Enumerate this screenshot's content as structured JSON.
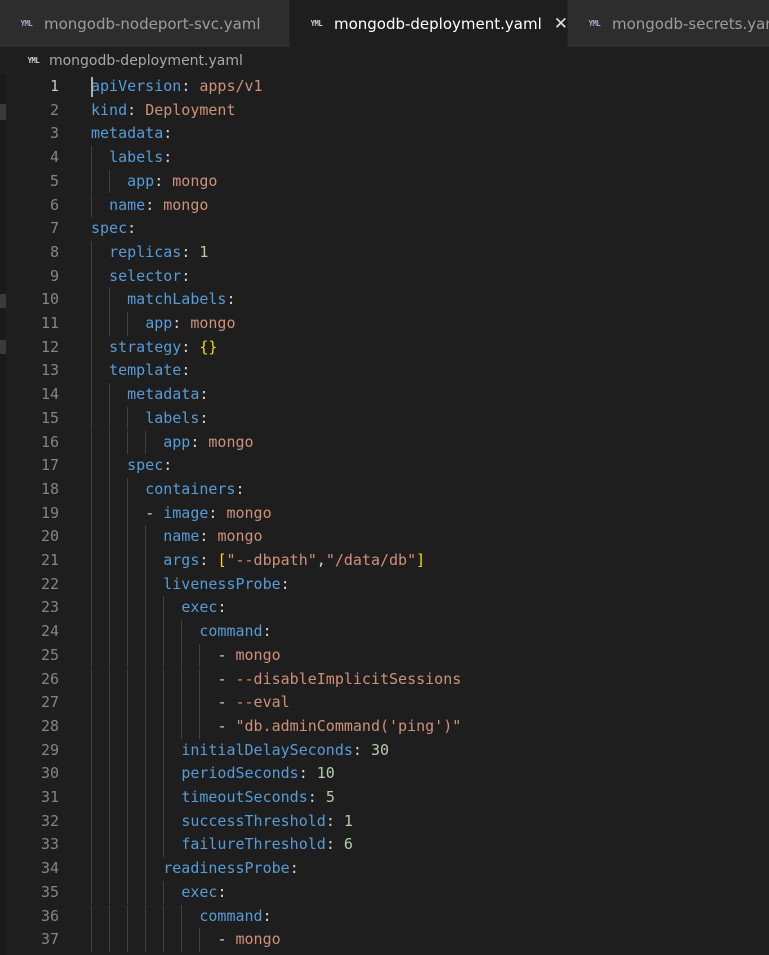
{
  "tabs": [
    {
      "label": "mongodb-nodeport-svc.yaml",
      "icon": "yml-icon"
    },
    {
      "label": "mongodb-deployment.yaml",
      "icon": "yml-icon",
      "active": true,
      "close": "✕"
    },
    {
      "label": "mongodb-secrets.yaml",
      "icon": "yml-icon"
    }
  ],
  "icon_text": "YML",
  "breadcrumb": "mongodb-deployment.yaml",
  "lines": [
    {
      "n": "1",
      "indent": 0,
      "parts": [
        [
          "k",
          "apiVersion"
        ],
        [
          "p",
          ": "
        ],
        [
          "s",
          "apps/v1"
        ]
      ]
    },
    {
      "n": "2",
      "indent": 0,
      "parts": [
        [
          "k",
          "kind"
        ],
        [
          "p",
          ": "
        ],
        [
          "s",
          "Deployment"
        ]
      ]
    },
    {
      "n": "3",
      "indent": 0,
      "parts": [
        [
          "k",
          "metadata"
        ],
        [
          "p",
          ":"
        ]
      ]
    },
    {
      "n": "4",
      "indent": 1,
      "parts": [
        [
          "k",
          "labels"
        ],
        [
          "p",
          ":"
        ]
      ]
    },
    {
      "n": "5",
      "indent": 2,
      "parts": [
        [
          "k",
          "app"
        ],
        [
          "p",
          ": "
        ],
        [
          "s",
          "mongo"
        ]
      ]
    },
    {
      "n": "6",
      "indent": 1,
      "parts": [
        [
          "k",
          "name"
        ],
        [
          "p",
          ": "
        ],
        [
          "s",
          "mongo"
        ]
      ]
    },
    {
      "n": "7",
      "indent": 0,
      "parts": [
        [
          "k",
          "spec"
        ],
        [
          "p",
          ":"
        ]
      ]
    },
    {
      "n": "8",
      "indent": 1,
      "parts": [
        [
          "k",
          "replicas"
        ],
        [
          "p",
          ": "
        ],
        [
          "n",
          "1"
        ]
      ]
    },
    {
      "n": "9",
      "indent": 1,
      "parts": [
        [
          "k",
          "selector"
        ],
        [
          "p",
          ":"
        ]
      ]
    },
    {
      "n": "10",
      "indent": 2,
      "parts": [
        [
          "k",
          "matchLabels"
        ],
        [
          "p",
          ":"
        ]
      ]
    },
    {
      "n": "11",
      "indent": 3,
      "parts": [
        [
          "k",
          "app"
        ],
        [
          "p",
          ": "
        ],
        [
          "s",
          "mongo"
        ]
      ]
    },
    {
      "n": "12",
      "indent": 1,
      "parts": [
        [
          "k",
          "strategy"
        ],
        [
          "p",
          ": "
        ],
        [
          "b",
          "{}"
        ]
      ]
    },
    {
      "n": "13",
      "indent": 1,
      "parts": [
        [
          "k",
          "template"
        ],
        [
          "p",
          ":"
        ]
      ]
    },
    {
      "n": "14",
      "indent": 2,
      "parts": [
        [
          "k",
          "metadata"
        ],
        [
          "p",
          ":"
        ]
      ]
    },
    {
      "n": "15",
      "indent": 3,
      "parts": [
        [
          "k",
          "labels"
        ],
        [
          "p",
          ":"
        ]
      ]
    },
    {
      "n": "16",
      "indent": 4,
      "parts": [
        [
          "k",
          "app"
        ],
        [
          "p",
          ": "
        ],
        [
          "s",
          "mongo"
        ]
      ]
    },
    {
      "n": "17",
      "indent": 2,
      "parts": [
        [
          "k",
          "spec"
        ],
        [
          "p",
          ":"
        ]
      ]
    },
    {
      "n": "18",
      "indent": 3,
      "parts": [
        [
          "k",
          "containers"
        ],
        [
          "p",
          ":"
        ]
      ]
    },
    {
      "n": "19",
      "indent": 3,
      "parts": [
        [
          "p",
          "- "
        ],
        [
          "k",
          "image"
        ],
        [
          "p",
          ": "
        ],
        [
          "s",
          "mongo"
        ]
      ]
    },
    {
      "n": "20",
      "indent": 4,
      "parts": [
        [
          "k",
          "name"
        ],
        [
          "p",
          ": "
        ],
        [
          "s",
          "mongo"
        ]
      ]
    },
    {
      "n": "21",
      "indent": 4,
      "parts": [
        [
          "k",
          "args"
        ],
        [
          "p",
          ": "
        ],
        [
          "b",
          "["
        ],
        [
          "s",
          "\"--dbpath\""
        ],
        [
          "p",
          ","
        ],
        [
          "s",
          "\"/data/db\""
        ],
        [
          "b",
          "]"
        ]
      ]
    },
    {
      "n": "22",
      "indent": 4,
      "parts": [
        [
          "k",
          "livenessProbe"
        ],
        [
          "p",
          ":"
        ]
      ]
    },
    {
      "n": "23",
      "indent": 5,
      "parts": [
        [
          "k",
          "exec"
        ],
        [
          "p",
          ":"
        ]
      ]
    },
    {
      "n": "24",
      "indent": 6,
      "parts": [
        [
          "k",
          "command"
        ],
        [
          "p",
          ":"
        ]
      ]
    },
    {
      "n": "25",
      "indent": 7,
      "parts": [
        [
          "p",
          "- "
        ],
        [
          "s",
          "mongo"
        ]
      ]
    },
    {
      "n": "26",
      "indent": 7,
      "parts": [
        [
          "p",
          "- "
        ],
        [
          "s",
          "--disableImplicitSessions"
        ]
      ]
    },
    {
      "n": "27",
      "indent": 7,
      "parts": [
        [
          "p",
          "- "
        ],
        [
          "s",
          "--eval"
        ]
      ]
    },
    {
      "n": "28",
      "indent": 7,
      "parts": [
        [
          "p",
          "- "
        ],
        [
          "s",
          "\"db.adminCommand('ping')\""
        ]
      ]
    },
    {
      "n": "29",
      "indent": 5,
      "parts": [
        [
          "k",
          "initialDelaySeconds"
        ],
        [
          "p",
          ": "
        ],
        [
          "n",
          "30"
        ]
      ]
    },
    {
      "n": "30",
      "indent": 5,
      "parts": [
        [
          "k",
          "periodSeconds"
        ],
        [
          "p",
          ": "
        ],
        [
          "n",
          "10"
        ]
      ]
    },
    {
      "n": "31",
      "indent": 5,
      "parts": [
        [
          "k",
          "timeoutSeconds"
        ],
        [
          "p",
          ": "
        ],
        [
          "n",
          "5"
        ]
      ]
    },
    {
      "n": "32",
      "indent": 5,
      "parts": [
        [
          "k",
          "successThreshold"
        ],
        [
          "p",
          ": "
        ],
        [
          "n",
          "1"
        ]
      ]
    },
    {
      "n": "33",
      "indent": 5,
      "parts": [
        [
          "k",
          "failureThreshold"
        ],
        [
          "p",
          ": "
        ],
        [
          "n",
          "6"
        ]
      ]
    },
    {
      "n": "34",
      "indent": 4,
      "parts": [
        [
          "k",
          "readinessProbe"
        ],
        [
          "p",
          ":"
        ]
      ]
    },
    {
      "n": "35",
      "indent": 5,
      "parts": [
        [
          "k",
          "exec"
        ],
        [
          "p",
          ":"
        ]
      ]
    },
    {
      "n": "36",
      "indent": 6,
      "parts": [
        [
          "k",
          "command"
        ],
        [
          "p",
          ":"
        ]
      ]
    },
    {
      "n": "37",
      "indent": 7,
      "parts": [
        [
          "p",
          "- "
        ],
        [
          "s",
          "mongo"
        ]
      ]
    }
  ],
  "colors": {
    "background": "#1e1e1e",
    "key": "#569cd6",
    "string": "#ce9178",
    "number": "#b5cea8",
    "bracket": "#ffd700"
  }
}
